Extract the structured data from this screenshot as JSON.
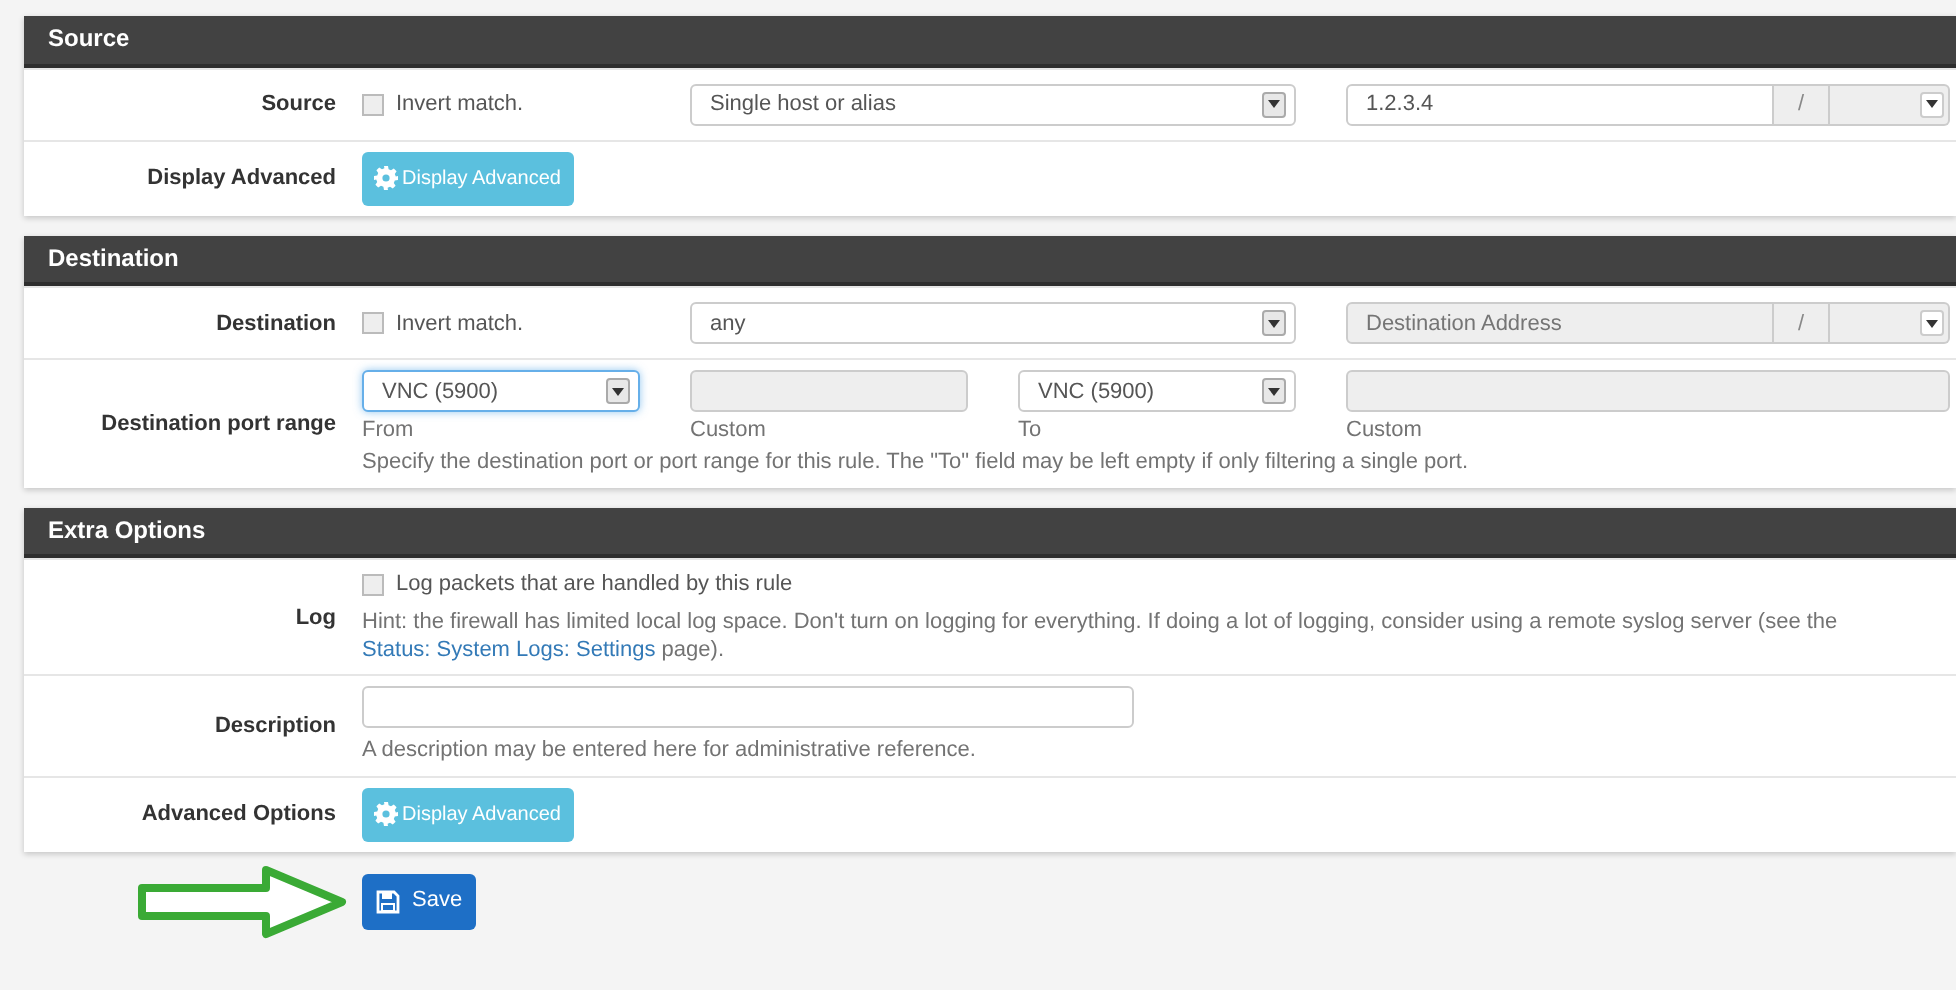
{
  "sections": [
    {
      "title": "Source",
      "rows": [
        {
          "kind": "address",
          "label": "Source",
          "invert": {
            "label": "Invert match.",
            "checked": false
          },
          "type_select": {
            "value": "Single host or alias"
          },
          "address": {
            "value": "1.2.3.4",
            "disabled": false
          },
          "separator": "/"
        },
        {
          "kind": "button",
          "label": "Display Advanced",
          "button": "Display Advanced"
        }
      ]
    },
    {
      "title": "Destination",
      "rows": [
        {
          "kind": "address",
          "label": "Destination",
          "invert": {
            "label": "Invert match.",
            "checked": false
          },
          "type_select": {
            "value": "any"
          },
          "address": {
            "placeholder": "Destination Address",
            "disabled": true
          },
          "separator": "/"
        },
        {
          "kind": "port_range",
          "label": "Destination port range",
          "from": {
            "value": "VNC (5900)",
            "focused": true,
            "caption": "From"
          },
          "from_custom": {
            "caption": "Custom"
          },
          "to": {
            "value": "VNC (5900)",
            "focused": false,
            "caption": "To"
          },
          "to_custom": {
            "caption": "Custom"
          },
          "help": "Specify the destination port or port range for this rule. The \"To\" field may be left empty if only filtering a single port."
        }
      ]
    },
    {
      "title": "Extra Options",
      "rows": [
        {
          "kind": "checkbox_hint",
          "label": "Log",
          "checkbox": {
            "label": "Log packets that are handled by this rule",
            "checked": false
          },
          "hint": {
            "before": "Hint: the firewall has limited local log space. Don't turn on logging for everything. If doing a lot of logging, consider using a remote syslog server (see the",
            "link": "Status: System Logs: Settings",
            "after": "page)."
          }
        },
        {
          "kind": "text_input",
          "label": "Description",
          "help": "A description may be entered here for administrative reference."
        },
        {
          "kind": "button",
          "label": "Advanced Options",
          "button": "Display Advanced"
        }
      ]
    }
  ],
  "save_button": "Save"
}
